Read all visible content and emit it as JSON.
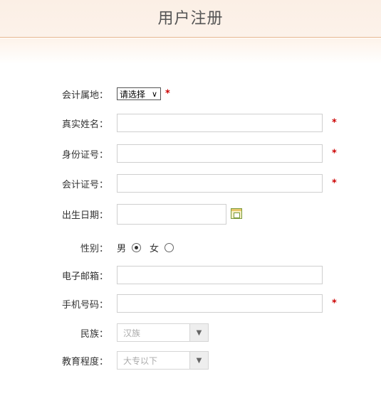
{
  "header": {
    "title": "用户注册"
  },
  "required_mark": "*",
  "form": {
    "accounting_place": {
      "label": "会计属地：",
      "selected": "请选择"
    },
    "real_name": {
      "label": "真实姓名：",
      "value": ""
    },
    "id_number": {
      "label": "身份证号：",
      "value": ""
    },
    "accounting_cert": {
      "label": "会计证号：",
      "value": ""
    },
    "birth_date": {
      "label": "出生日期：",
      "value": ""
    },
    "gender": {
      "label": "性别：",
      "options": [
        {
          "label": "男",
          "checked": true
        },
        {
          "label": "女",
          "checked": false
        }
      ]
    },
    "email": {
      "label": "电子邮箱：",
      "value": ""
    },
    "phone": {
      "label": "手机号码：",
      "value": ""
    },
    "ethnicity": {
      "label": "民族：",
      "selected": "汉族"
    },
    "education": {
      "label": "教育程度：",
      "selected": "大专以下"
    }
  },
  "icons": {
    "select_arrow": "chevron-down-icon",
    "calendar": "calendar-icon",
    "combo_arrow": "triangle-down-icon"
  }
}
